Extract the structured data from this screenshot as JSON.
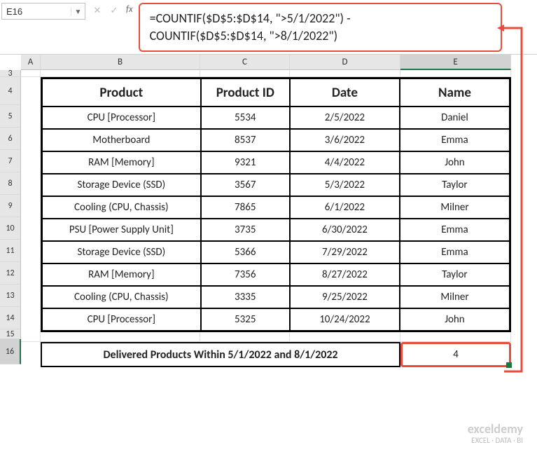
{
  "nameBox": "E16",
  "formula_line1": "=COUNTIF($D$5:$D$14, \">5/1/2022\") -",
  "formula_line2": "COUNTIF($D$5:$D$14, \">8/1/2022\")",
  "fx": "fx",
  "cols": {
    "A": "A",
    "B": "B",
    "C": "C",
    "D": "D",
    "E": "E"
  },
  "rows": [
    "3",
    "4",
    "5",
    "6",
    "7",
    "8",
    "9",
    "10",
    "11",
    "12",
    "13",
    "14",
    "15",
    "16"
  ],
  "headers": {
    "product": "Product",
    "productId": "Product ID",
    "date": "Date",
    "name": "Name"
  },
  "data": [
    {
      "product": "CPU [Processor]",
      "id": "5534",
      "date": "2/5/2022",
      "name": "Daniel"
    },
    {
      "product": "Motherboard",
      "id": "8537",
      "date": "3/6/2022",
      "name": "Emma"
    },
    {
      "product": "RAM [Memory]",
      "id": "9321",
      "date": "4/4/2022",
      "name": "John"
    },
    {
      "product": "Storage Device (SSD)",
      "id": "3567",
      "date": "5/3/2022",
      "name": "Taylor"
    },
    {
      "product": "Cooling (CPU, Chassis)",
      "id": "7865",
      "date": "6/1/2022",
      "name": "Milner"
    },
    {
      "product": "PSU [Power Supply Unit]",
      "id": "3735",
      "date": "6/30/2022",
      "name": "Emma"
    },
    {
      "product": "Storage Device (SSD)",
      "id": "5366",
      "date": "7/29/2022",
      "name": "Emma"
    },
    {
      "product": "RAM [Memory]",
      "id": "7356",
      "date": "8/27/2022",
      "name": "Taylor"
    },
    {
      "product": "Cooling (CPU, Chassis)",
      "id": "3335",
      "date": "9/25/2022",
      "name": "Milner"
    },
    {
      "product": "CPU [Processor]",
      "id": "5325",
      "date": "10/24/2022",
      "name": "John"
    }
  ],
  "footer": {
    "label": "Delivered Products Within 5/1/2022 and 8/1/2022",
    "result": "4"
  },
  "watermark": {
    "brand": "exceldemy",
    "tag": "EXCEL · DATA · BI"
  }
}
